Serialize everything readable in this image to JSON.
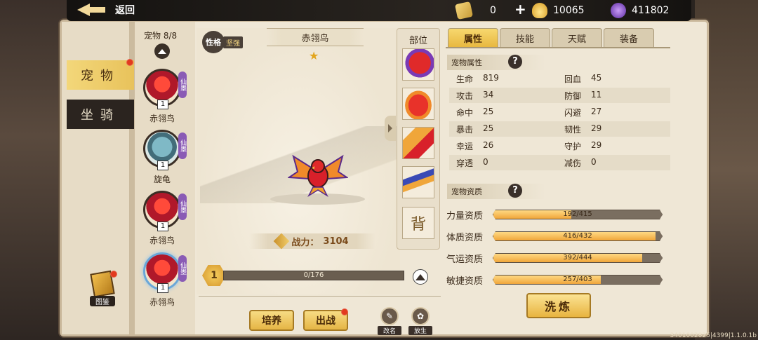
{
  "topbar": {
    "back_label": "返回",
    "resources": [
      {
        "name": "coupon",
        "icon": "coupon-icon",
        "value": "0"
      },
      {
        "name": "gold",
        "icon": "gold-ingot-icon",
        "value": "10065"
      },
      {
        "name": "gem",
        "icon": "purple-gem-icon",
        "value": "411802"
      }
    ],
    "plus_label": "+"
  },
  "sidebar": {
    "tabs": [
      {
        "label": "宠物",
        "active": true
      },
      {
        "label": "坐骑",
        "active": false
      }
    ],
    "atlas_label": "图鉴"
  },
  "pet_list": {
    "count_label": "宠物 8/8",
    "pets": [
      {
        "name": "赤翎鸟",
        "level": "1",
        "tag": "仙墨",
        "color": "red",
        "selected": false
      },
      {
        "name": "旋龟",
        "level": "1",
        "tag": "仙墨",
        "color": "blue",
        "selected": false
      },
      {
        "name": "赤翎鸟",
        "level": "1",
        "tag": "仙墨",
        "color": "red",
        "selected": false
      },
      {
        "name": "赤翎鸟",
        "level": "1",
        "tag": "仙墨",
        "color": "red",
        "selected": true
      }
    ]
  },
  "center": {
    "trait_badge": "性格",
    "trait_value": "坚强",
    "pet_title": "赤翎鸟",
    "star_count": 1,
    "power_label": "战力：",
    "power_value": "3104",
    "level": "1",
    "exp_text": "0/176",
    "exp_fraction": 0,
    "actions": {
      "train": "培养",
      "deploy": "出战",
      "rename": "改名",
      "release": "放生"
    }
  },
  "parts": {
    "title": "部位",
    "back_label": "背"
  },
  "tabs": [
    {
      "label": "属性",
      "active": true
    },
    {
      "label": "技能",
      "active": false
    },
    {
      "label": "天赋",
      "active": false
    },
    {
      "label": "装备",
      "active": false
    }
  ],
  "attributes": {
    "section_title": "宠物属性",
    "rows": [
      {
        "k1": "生命",
        "v1": "819",
        "k2": "回血",
        "v2": "45"
      },
      {
        "k1": "攻击",
        "v1": "34",
        "k2": "防御",
        "v2": "11"
      },
      {
        "k1": "命中",
        "v1": "25",
        "k2": "闪避",
        "v2": "27"
      },
      {
        "k1": "暴击",
        "v1": "25",
        "k2": "韧性",
        "v2": "29"
      },
      {
        "k1": "幸运",
        "v1": "26",
        "k2": "守护",
        "v2": "29"
      },
      {
        "k1": "穿透",
        "v1": "0",
        "k2": "减伤",
        "v2": "0"
      }
    ]
  },
  "aptitude": {
    "section_title": "宠物资质",
    "items": [
      {
        "label": "力量资质",
        "text": "192/415",
        "value": 192,
        "max": 415
      },
      {
        "label": "体质资质",
        "text": "416/432",
        "value": 416,
        "max": 432
      },
      {
        "label": "气运资质",
        "text": "392/444",
        "value": 392,
        "max": 444
      },
      {
        "label": "敏捷资质",
        "text": "257/403",
        "value": 257,
        "max": 403
      }
    ],
    "wash_label": "洗炼"
  },
  "footer": {
    "version": "3401002825|4399|1.1.0.1b"
  },
  "colors": {
    "accent": "#e8b840",
    "bar_fill": "#f0a63a",
    "red_dot": "#e23a1e"
  }
}
